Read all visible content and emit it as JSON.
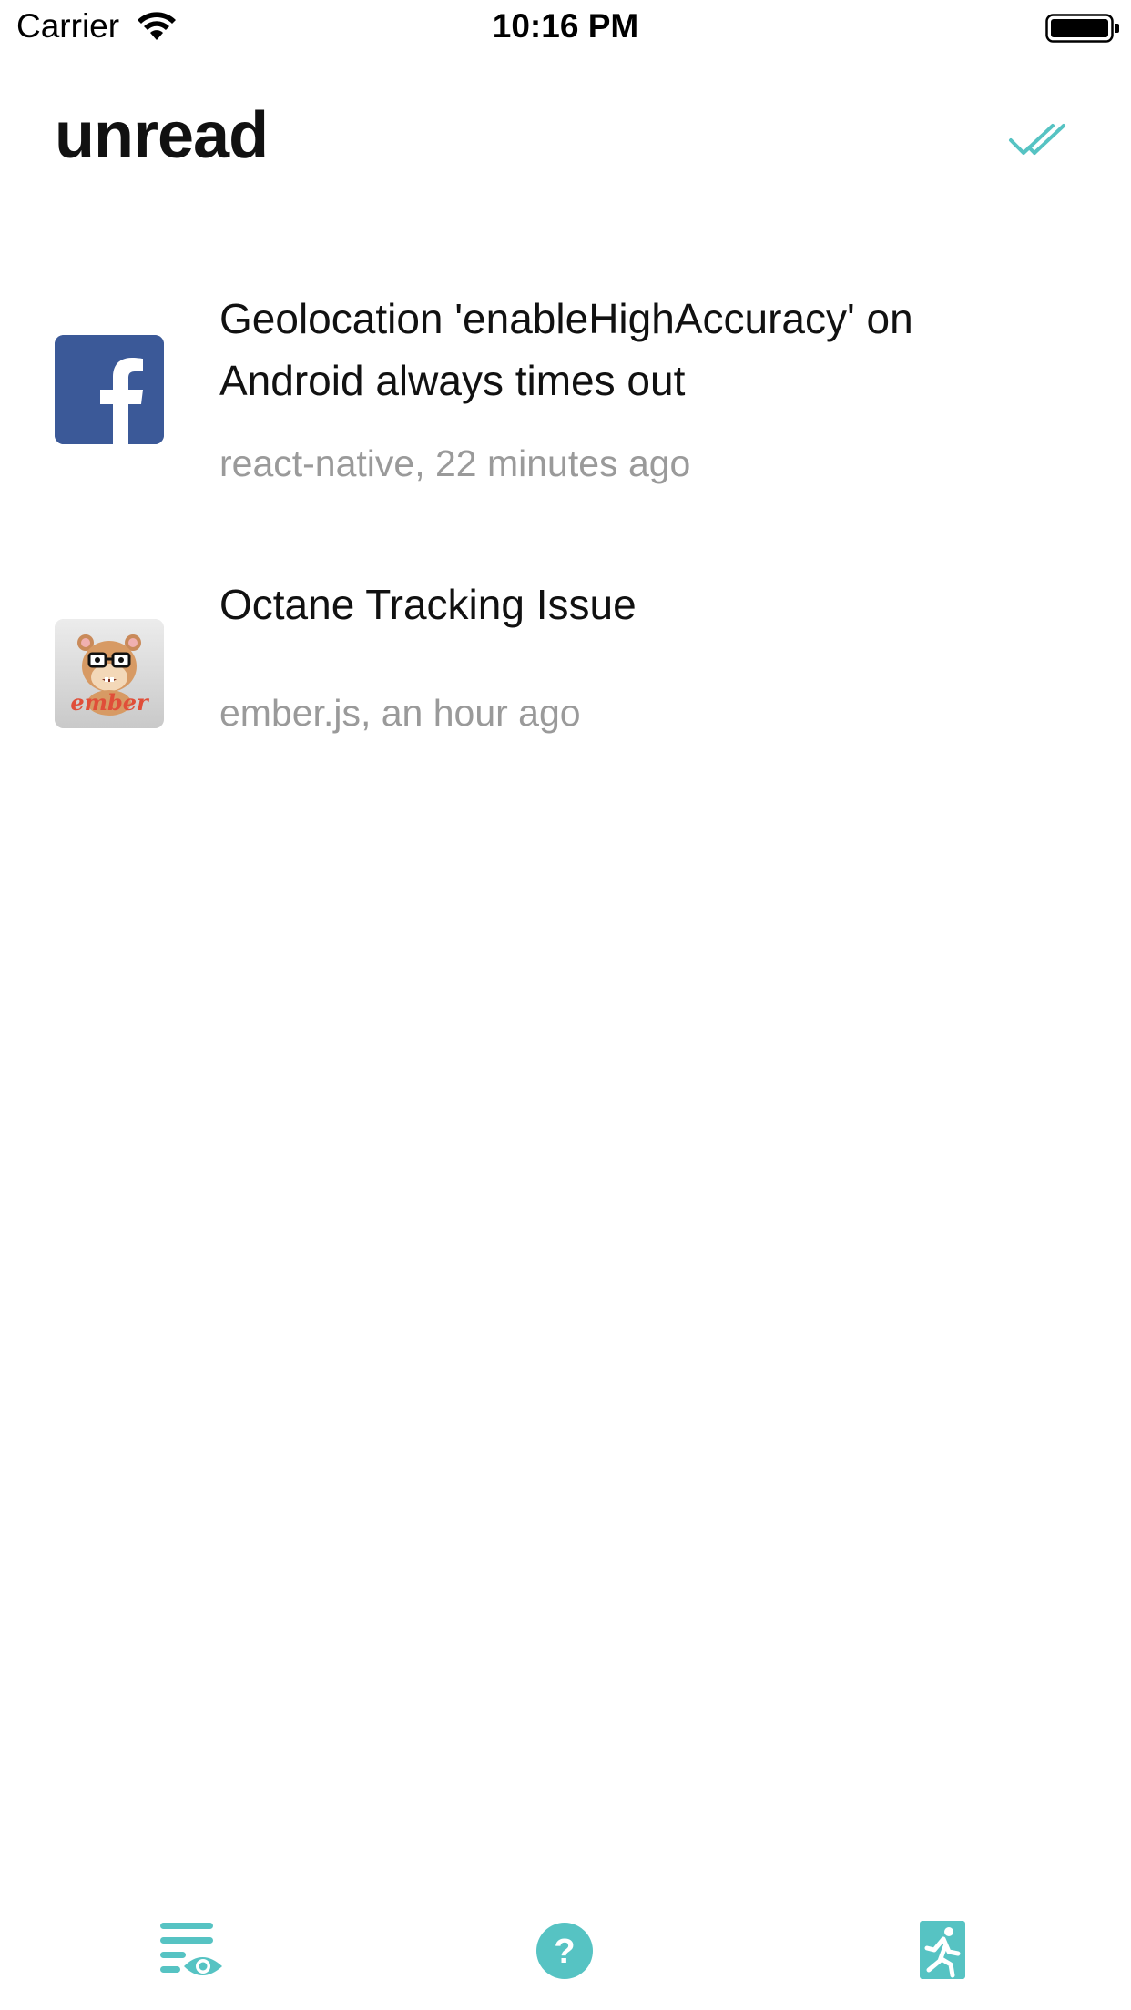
{
  "status_bar": {
    "carrier": "Carrier",
    "time": "10:16 PM",
    "wifi_icon": "wifi-icon",
    "battery_icon": "battery-icon"
  },
  "header": {
    "title": "unread",
    "action_icon": "double-check-icon"
  },
  "notifications": [
    {
      "avatar_icon": "facebook-logo",
      "title": "Geolocation 'enableHighAccuracy' on Android always times out",
      "meta": "react-native, 22 minutes ago"
    },
    {
      "avatar_icon": "ember-logo",
      "title": "Octane Tracking Issue",
      "meta": "ember.js, an hour ago"
    }
  ],
  "tab_bar": {
    "tabs": [
      {
        "icon": "watching-list-icon"
      },
      {
        "icon": "help-icon"
      },
      {
        "icon": "exit-icon"
      }
    ]
  },
  "colors": {
    "accent": "#56c3c3",
    "facebook_blue": "#3b5998",
    "meta_gray": "#9a9a9a"
  }
}
